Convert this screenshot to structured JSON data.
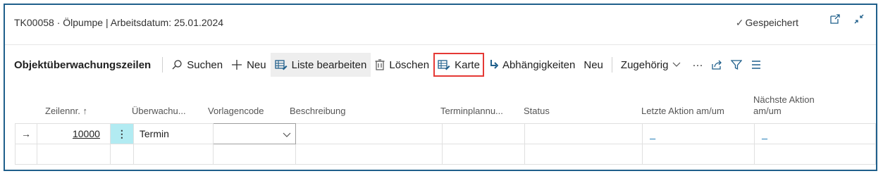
{
  "header": {
    "title": "TK00058 · Ölpumpe | Arbeitsdatum: 25.01.2024",
    "saved_label": "Gespeichert"
  },
  "toolbar": {
    "title": "Objektüberwachungszeilen",
    "search": "Suchen",
    "new": "Neu",
    "edit_list": "Liste bearbeiten",
    "delete": "Löschen",
    "card": "Karte",
    "dependencies": "Abhängigkeiten",
    "new2": "Neu",
    "related": "Zugehörig",
    "more": "···"
  },
  "columns": {
    "line_no": "Zeilennr. ↑",
    "monitoring": "Überwachu...",
    "template_code": "Vorlagencode",
    "description": "Beschreibung",
    "scheduling": "Terminplannu...",
    "status": "Status",
    "last_action": "Letzte Aktion am/um",
    "next_action_1": "Nächste Aktion",
    "next_action_2": "am/um"
  },
  "rows": [
    {
      "indicator": "→",
      "line_no": "10000",
      "menu": "⋮",
      "monitoring": "Termin",
      "template_code": "",
      "description": "",
      "scheduling": "",
      "status": "",
      "last_action": "_",
      "next_action": "_"
    }
  ],
  "colors": {
    "frame": "#1f5f8b",
    "highlight": "#e53935",
    "row_menu": "#b2ebf2",
    "link": "#0b6fb0"
  },
  "icons": [
    "checkmark-icon",
    "open-new-window-icon",
    "collapse-icon",
    "search-icon",
    "plus-icon",
    "edit-list-icon",
    "trash-icon",
    "card-icon",
    "dependencies-icon",
    "chevron-down-icon",
    "share-icon",
    "filter-icon",
    "list-view-icon"
  ]
}
